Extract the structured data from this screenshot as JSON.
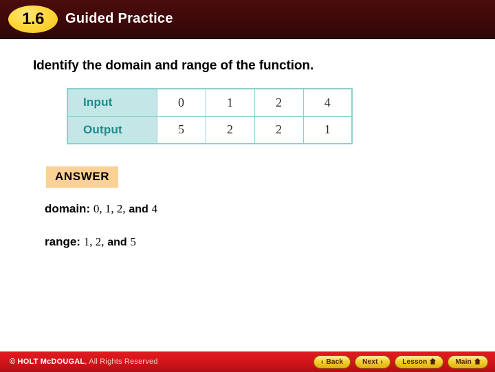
{
  "header": {
    "badge_label": "1.6",
    "title": "Guided Practice"
  },
  "main": {
    "question": "Identify the domain and range of the function.",
    "table": {
      "rows": [
        {
          "label": "Input",
          "values": [
            "0",
            "1",
            "2",
            "4"
          ]
        },
        {
          "label": "Output",
          "values": [
            "5",
            "2",
            "2",
            "1"
          ]
        }
      ]
    },
    "answer": {
      "badge_label": "ANSWER",
      "domain_label": "domain:",
      "domain_values": "0, 1, 2,",
      "domain_conjunction": "and",
      "domain_last": "4",
      "range_label": "range:",
      "range_values": "1, 2,",
      "range_conjunction": "and",
      "range_last": "5"
    }
  },
  "footer": {
    "copyright_strong": "© HOLT McDOUGAL",
    "copyright_rest": ", All Rights Reserved",
    "buttons": [
      {
        "label": "Back",
        "icon": "chevron-left-icon",
        "glyph": "‹",
        "icon_side": "left"
      },
      {
        "label": "Next",
        "icon": "chevron-right-icon",
        "glyph": "›",
        "icon_side": "right"
      },
      {
        "label": "Lesson",
        "icon": "home-icon",
        "glyph": "⌂",
        "icon_side": "right"
      },
      {
        "label": "Main",
        "icon": "home-icon",
        "glyph": "⌂",
        "icon_side": "right"
      }
    ]
  },
  "colors": {
    "header_bg": "#3e0909",
    "badge_gold": "#ffd83e",
    "table_header_bg": "#c3e6e6",
    "table_header_text": "#1f8a8c",
    "table_border": "#8fcfd0",
    "answer_badge_bg": "#fbd195",
    "footer_red": "#d1151a",
    "nav_button_gold": "#f5d233"
  }
}
